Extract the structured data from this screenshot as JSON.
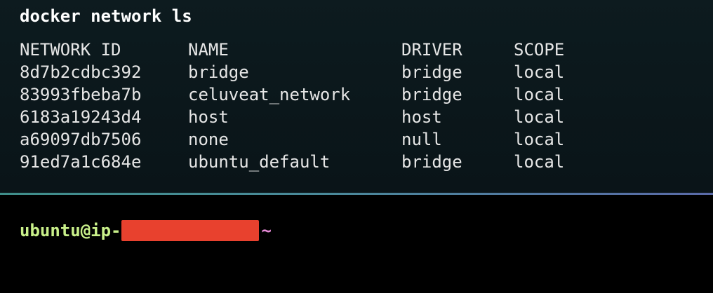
{
  "command": {
    "text": "docker network ls"
  },
  "table": {
    "headers": {
      "network_id": "NETWORK ID",
      "name": "NAME",
      "driver": "DRIVER",
      "scope": "SCOPE"
    },
    "rows": [
      {
        "network_id": "8d7b2cdbc392",
        "name": "bridge",
        "driver": "bridge",
        "scope": "local"
      },
      {
        "network_id": "83993fbeba7b",
        "name": "celuveat_network",
        "driver": "bridge",
        "scope": "local"
      },
      {
        "network_id": "6183a19243d4",
        "name": "host",
        "driver": "host",
        "scope": "local"
      },
      {
        "network_id": "a69097db7506",
        "name": "none",
        "driver": "null",
        "scope": "local"
      },
      {
        "network_id": "91ed7a1c684e",
        "name": "ubuntu_default",
        "driver": "bridge",
        "scope": "local"
      }
    ]
  },
  "prompt": {
    "user_host": "ubuntu@ip-",
    "path": "~"
  },
  "colors": {
    "output_background": "#0b171b",
    "terminal_background": "#000000",
    "prompt_user": "#c9f08a",
    "prompt_path": "#e88bd8",
    "redaction": "#e8412e"
  }
}
